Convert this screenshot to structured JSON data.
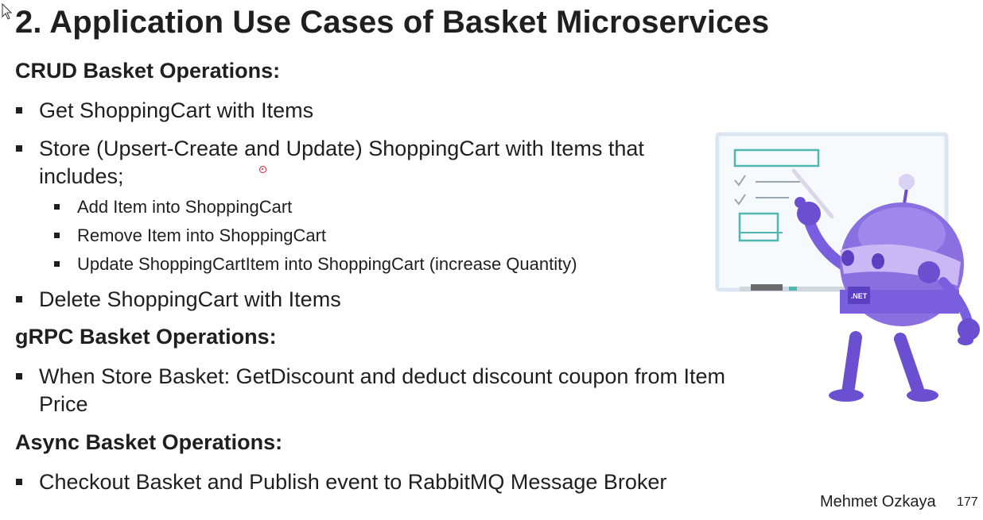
{
  "slide": {
    "title": "2. Application Use Cases of Basket Microservices",
    "sections": [
      {
        "heading": "CRUD Basket Operations:",
        "bullets": [
          "Get ShoppingCart with Items",
          "Store (Upsert-Create and Update) ShoppingCart with Items that includes;",
          "Delete ShoppingCart with Items"
        ],
        "sub_bullets": [
          "Add Item into ShoppingCart",
          "Remove Item into ShoppingCart",
          "Update ShoppingCartItem into ShoppingCart (increase Quantity)"
        ]
      },
      {
        "heading": "gRPC Basket Operations:",
        "bullets": [
          "When Store Basket: GetDiscount and deduct discount coupon from Item Price"
        ]
      },
      {
        "heading": "Async Basket Operations:",
        "bullets": [
          "Checkout Basket and Publish event to RabbitMQ Message Broker"
        ]
      }
    ],
    "illustration": {
      "name": "dotnet-bot-whiteboard",
      "badge": ".NET",
      "colors": {
        "body": "#8a6fe0",
        "dark": "#6a4fd0",
        "light": "#c9b8f5",
        "board_lines": "#4fb7b0"
      }
    },
    "footer": {
      "author": "Mehmet Ozkaya",
      "page": "177"
    },
    "icons": [
      "mouse-cursor-icon",
      "pointer-dot-icon"
    ]
  }
}
